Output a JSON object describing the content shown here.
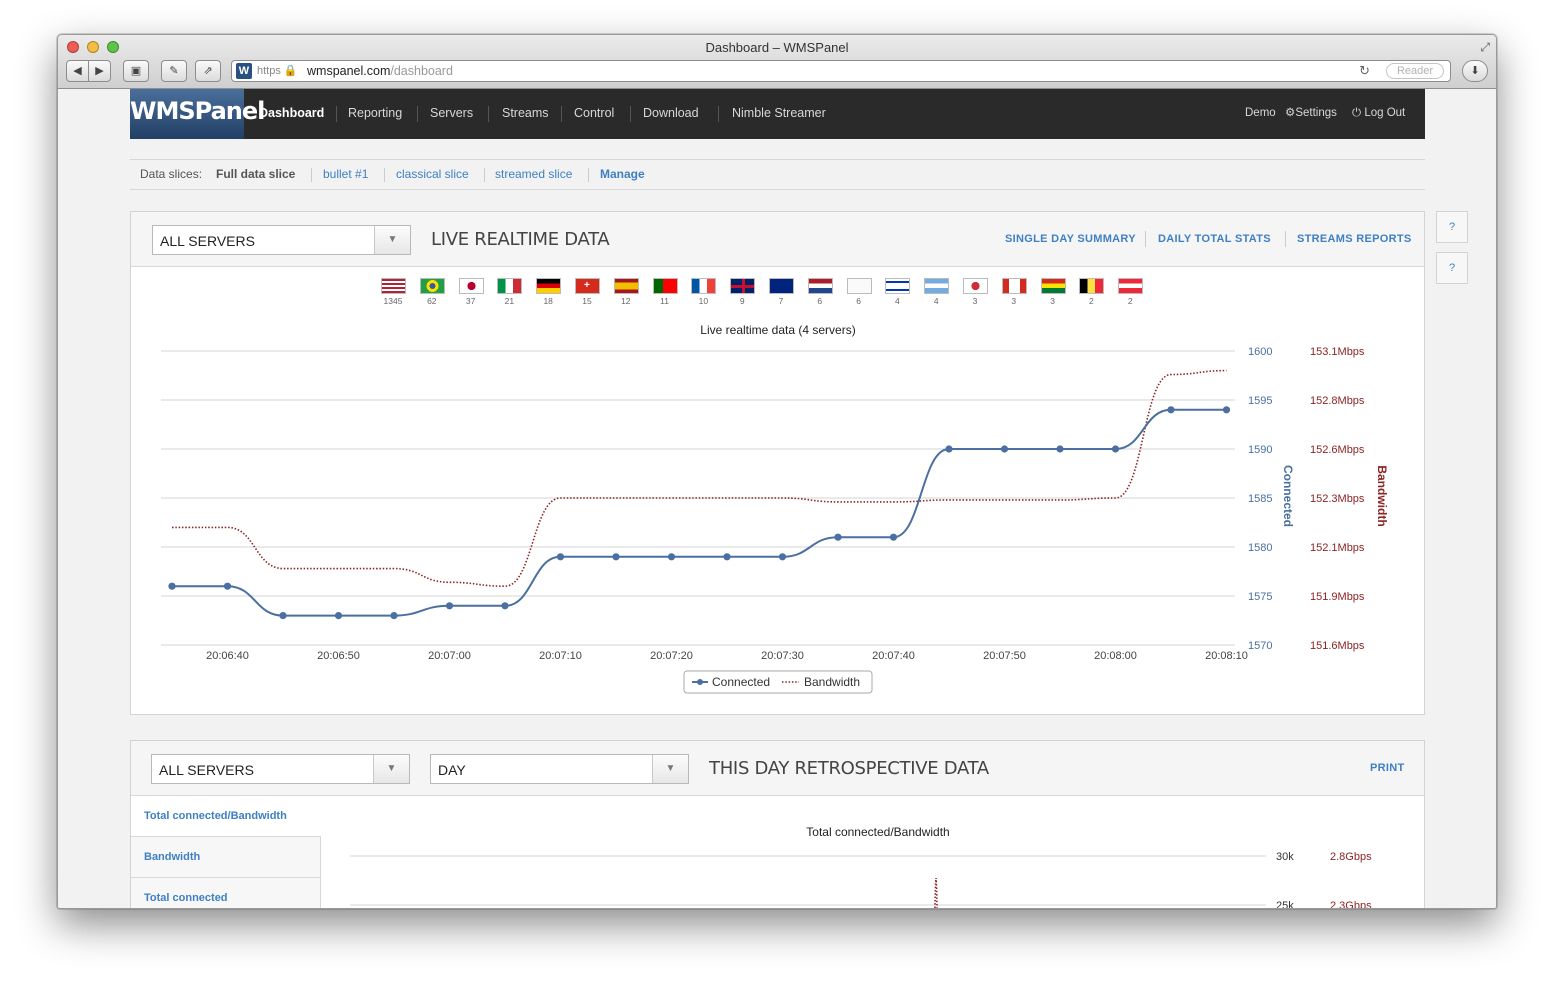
{
  "window": {
    "title": "Dashboard – WMSPanel"
  },
  "browser": {
    "https_label": "https",
    "url_host": "wmspanel.com",
    "url_path": "/dashboard",
    "reader_label": "Reader",
    "favicon_letter": "W"
  },
  "topnav": {
    "logo": "WMSPanel",
    "items": [
      {
        "label": "Dashboard",
        "active": true
      },
      {
        "label": "Reporting"
      },
      {
        "label": "Servers"
      },
      {
        "label": "Streams"
      },
      {
        "label": "Control"
      },
      {
        "label": "Download"
      },
      {
        "label": "Nimble Streamer"
      }
    ],
    "user": "Demo",
    "settings": "Settings",
    "logout": "Log Out"
  },
  "slices": {
    "label": "Data slices:",
    "current": "Full data slice",
    "items": [
      "bullet #1",
      "classical slice",
      "streamed slice"
    ],
    "manage": "Manage"
  },
  "live_panel": {
    "server_select": "ALL SERVERS",
    "title": "LIVE REALTIME DATA",
    "links": [
      "SINGLE DAY SUMMARY",
      "DAILY TOTAL STATS",
      "STREAMS REPORTS"
    ],
    "help": "?",
    "flags": [
      {
        "country": "us",
        "count": "1345"
      },
      {
        "country": "br",
        "count": "62"
      },
      {
        "country": "jp",
        "count": "37"
      },
      {
        "country": "it",
        "count": "21"
      },
      {
        "country": "de",
        "count": "18"
      },
      {
        "country": "ch",
        "count": "15"
      },
      {
        "country": "es",
        "count": "12"
      },
      {
        "country": "pt",
        "count": "11"
      },
      {
        "country": "fr",
        "count": "10"
      },
      {
        "country": "gb",
        "count": "9"
      },
      {
        "country": "au",
        "count": "7"
      },
      {
        "country": "nl",
        "count": "6"
      },
      {
        "country": "unknown",
        "count": "6"
      },
      {
        "country": "il",
        "count": "4"
      },
      {
        "country": "ar",
        "count": "4"
      },
      {
        "country": "kr",
        "count": "3"
      },
      {
        "country": "ca",
        "count": "3"
      },
      {
        "country": "bo",
        "count": "3"
      },
      {
        "country": "be",
        "count": "2"
      },
      {
        "country": "at",
        "count": "2"
      }
    ]
  },
  "day_panel": {
    "server_select": "ALL SERVERS",
    "period_select": "DAY",
    "title": "THIS DAY RETROSPECTIVE DATA",
    "print": "PRINT",
    "help": "?",
    "tabs": [
      "Total connected/Bandwidth",
      "Bandwidth",
      "Total connected"
    ]
  },
  "colors": {
    "connected": "#4a6fa0",
    "bandwidth": "#8b2424",
    "link": "#3f7fc4",
    "nav_bg": "#2a2a2a"
  },
  "chart_data": [
    {
      "type": "line",
      "title": "Live realtime data (4 servers)",
      "x": [
        "20:06:35",
        "20:06:40",
        "20:06:45",
        "20:06:50",
        "20:06:55",
        "20:07:00",
        "20:07:05",
        "20:07:10",
        "20:07:15",
        "20:07:20",
        "20:07:25",
        "20:07:30",
        "20:07:35",
        "20:07:40",
        "20:07:45",
        "20:07:50",
        "20:07:55",
        "20:08:00",
        "20:08:05",
        "20:08:10"
      ],
      "x_ticks": [
        "20:06:40",
        "20:06:50",
        "20:07:00",
        "20:07:10",
        "20:07:20",
        "20:07:30",
        "20:07:40",
        "20:07:50",
        "20:08:00",
        "20:08:10"
      ],
      "series": [
        {
          "name": "Connected",
          "axis": "left",
          "style": "solid-markers",
          "values": [
            1576,
            1576,
            1573,
            1573,
            1573,
            1574,
            1574,
            1579,
            1579,
            1579,
            1579,
            1579,
            1581,
            1581,
            1590,
            1590,
            1590,
            1590,
            1594,
            1594
          ]
        },
        {
          "name": "Bandwidth",
          "axis": "right",
          "unit": "Mbps",
          "style": "dotted",
          "values": [
            152.2,
            152.2,
            151.99,
            151.99,
            151.99,
            151.92,
            151.9,
            152.35,
            152.35,
            152.35,
            152.35,
            152.35,
            152.33,
            152.33,
            152.34,
            152.34,
            152.34,
            152.35,
            152.98,
            153.0
          ]
        }
      ],
      "y_left": {
        "label": "Connected",
        "ticks": [
          "1600",
          "1595",
          "1590",
          "1585",
          "1580",
          "1575",
          "1570"
        ],
        "ylim": [
          1570,
          1600
        ]
      },
      "y_right": {
        "label": "Bandwidth",
        "ticks": [
          "153.1Mbps",
          "152.8Mbps",
          "152.6Mbps",
          "152.3Mbps",
          "152.1Mbps",
          "151.9Mbps",
          "151.6Mbps"
        ],
        "ylim": [
          151.6,
          153.1
        ]
      },
      "legend": {
        "position": "bottom-center",
        "entries": [
          "Connected",
          "Bandwidth"
        ]
      },
      "grid": true
    },
    {
      "type": "line",
      "title": "Total connected/Bandwidth",
      "y_left": {
        "ticks": [
          "30k",
          "25k"
        ]
      },
      "y_right": {
        "ticks": [
          "2.8Gbps",
          "2.3Gbps"
        ]
      },
      "grid": true
    }
  ]
}
